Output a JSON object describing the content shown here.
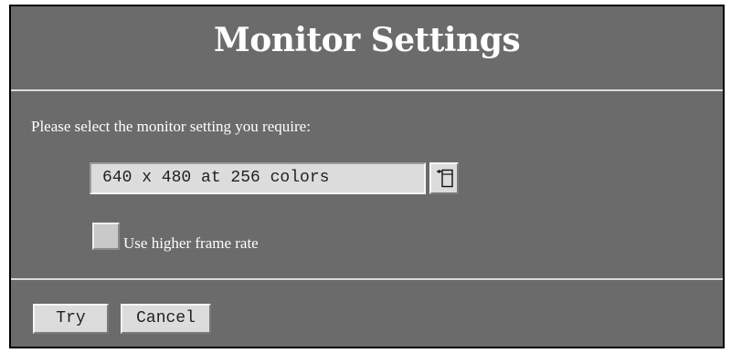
{
  "dialog": {
    "title": "Monitor Settings",
    "prompt": "Please select the monitor setting you require:",
    "resolution_select": {
      "selected_value": "640 x 480 at 256 colors",
      "button_icon": "dropdown-list-icon"
    },
    "higher_frame_rate": {
      "label": "Use higher frame rate",
      "checked": false
    },
    "buttons": {
      "try_label": "Try",
      "cancel_label": "Cancel"
    }
  },
  "colors": {
    "dialog_background": "#6b6b6b",
    "text": "#ffffff",
    "control_face": "#dcdcdc",
    "divider": "#dcdcdc"
  }
}
